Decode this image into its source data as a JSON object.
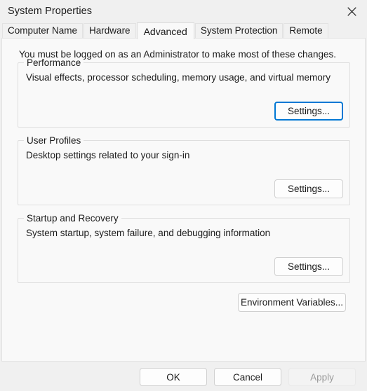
{
  "window": {
    "title": "System Properties",
    "close_icon": "close-icon"
  },
  "tabs": [
    {
      "label": "Computer Name",
      "selected": false
    },
    {
      "label": "Hardware",
      "selected": false
    },
    {
      "label": "Advanced",
      "selected": true
    },
    {
      "label": "System Protection",
      "selected": false
    },
    {
      "label": "Remote",
      "selected": false
    }
  ],
  "panel": {
    "admin_note": "You must be logged on as an Administrator to make most of these changes.",
    "groups": [
      {
        "title": "Performance",
        "description": "Visual effects, processor scheduling, memory usage, and virtual memory",
        "button_label": "Settings...",
        "button_focused": true
      },
      {
        "title": "User Profiles",
        "description": "Desktop settings related to your sign-in",
        "button_label": "Settings...",
        "button_focused": false
      },
      {
        "title": "Startup and Recovery",
        "description": "System startup, system failure, and debugging information",
        "button_label": "Settings...",
        "button_focused": false
      }
    ],
    "environment_variables_label": "Environment Variables..."
  },
  "footer": {
    "ok_label": "OK",
    "cancel_label": "Cancel",
    "apply_label": "Apply",
    "apply_enabled": false
  },
  "colors": {
    "accent": "#0078d4",
    "dialog_background": "#f0f0f0",
    "panel_background": "#f9f9f9",
    "text": "#1b1b1b",
    "disabled_text": "#9a9a9a",
    "group_border": "#dedede"
  }
}
